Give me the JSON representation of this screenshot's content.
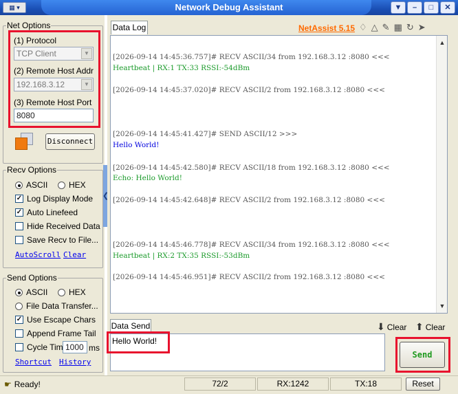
{
  "window": {
    "title": "Network Debug Assistant",
    "buttons": [
      "–",
      "□",
      "✕"
    ]
  },
  "net_options": {
    "legend": "Net Options",
    "protocol_label": "(1) Protocol",
    "protocol_value": "TCP Client",
    "host_label": "(2) Remote Host Addr",
    "host_value": "192.168.3.12",
    "port_label": "(3) Remote Host Port",
    "port_value": "8080",
    "disconnect_label": "Disconnect"
  },
  "recv_options": {
    "legend": "Recv Options",
    "ascii": "ASCII",
    "hex": "HEX",
    "log_display": "Log Display Mode",
    "auto_linefeed": "Auto Linefeed",
    "hide_received": "Hide Received Data",
    "save_to_file": "Save Recv to File...",
    "autoscroll": "AutoScroll",
    "clear": "Clear"
  },
  "send_options": {
    "legend": "Send Options",
    "ascii": "ASCII",
    "hex": "HEX",
    "file_data": "File Data Transfer...",
    "escape_chars": "Use Escape Chars",
    "append_frame": "Append Frame Tail",
    "cycle_time": "Cycle Time",
    "cycle_value": "1000",
    "cycle_unit": "ms",
    "shortcut": "Shortcut",
    "history": "History"
  },
  "log": {
    "tab": "Data Log",
    "brand": "NetAssist 5.15",
    "entries": [
      {
        "meta": "[2026-09-14 14:45:36.757]# RECV ASCII/34 from 192.168.3.12 :8080 <<<",
        "text": "Heartbeat | RX:1 TX:33 RSSI:-54dBm",
        "kind": "recv"
      },
      {
        "meta": "[2026-09-14 14:45:37.020]# RECV ASCII/2 from 192.168.3.12 :8080 <<<",
        "text": "",
        "kind": "recv"
      },
      {
        "meta": "[2026-09-14 14:45:41.427]# SEND ASCII/12 >>>",
        "text": "Hello World!",
        "kind": "send"
      },
      {
        "meta": "[2026-09-14 14:45:42.580]# RECV ASCII/18 from 192.168.3.12 :8080 <<<",
        "text": "Echo: Hello World!",
        "kind": "recv"
      },
      {
        "meta": "[2026-09-14 14:45:42.648]# RECV ASCII/2 from 192.168.3.12 :8080 <<<",
        "text": "",
        "kind": "recv"
      },
      {
        "meta": "[2026-09-14 14:45:46.778]# RECV ASCII/34 from 192.168.3.12 :8080 <<<",
        "text": "Heartbeat | RX:2 TX:35 RSSI:-53dBm",
        "kind": "recv"
      },
      {
        "meta": "[2026-09-14 14:45:46.951]# RECV ASCII/2 from 192.168.3.12 :8080 <<<",
        "text": "",
        "kind": "recv"
      }
    ]
  },
  "data_send": {
    "tab": "Data Send",
    "clear1": "Clear",
    "clear2": "Clear",
    "value": "Hello World!",
    "send_label": "Send"
  },
  "status": {
    "ready": "Ready!",
    "count": "72/2",
    "rx": "RX:1242",
    "tx": "TX:18",
    "reset": "Reset"
  },
  "colors": {
    "highlight": "#e8112d",
    "recv_text": "#1a9a2a",
    "send_text": "#0000dd",
    "brand": "#ff6a00"
  }
}
